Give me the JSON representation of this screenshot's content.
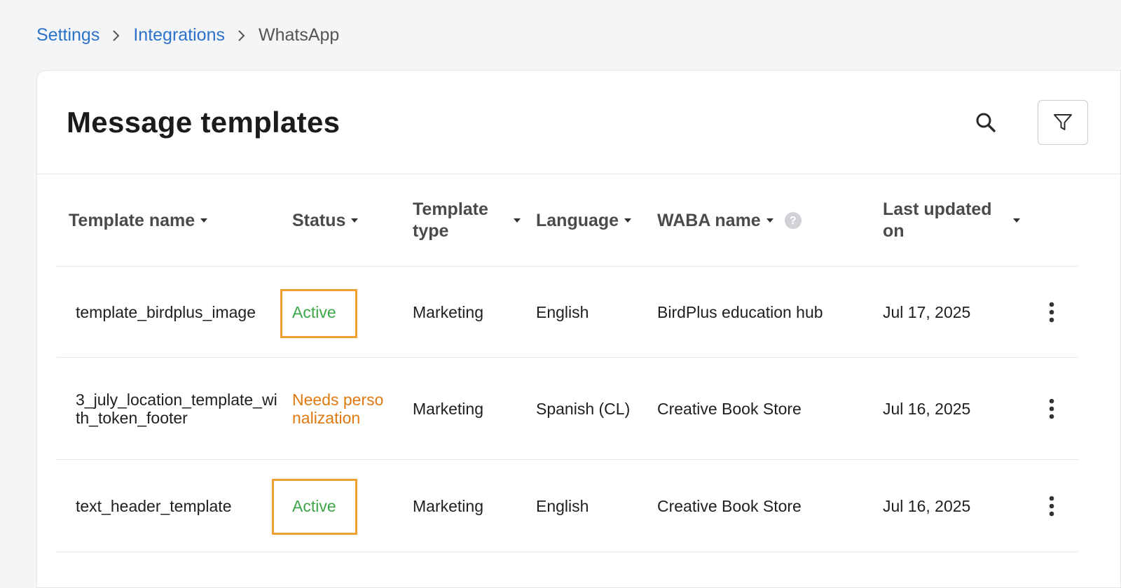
{
  "breadcrumb": {
    "items": [
      {
        "label": "Settings"
      },
      {
        "label": "Integrations"
      },
      {
        "label": "WhatsApp"
      }
    ]
  },
  "header": {
    "title": "Message templates",
    "search_icon": "search-icon",
    "filter_icon": "filter-icon"
  },
  "table": {
    "columns": [
      {
        "label": "Template name"
      },
      {
        "label": "Status"
      },
      {
        "label": "Template type"
      },
      {
        "label": "Language"
      },
      {
        "label": "WABA name"
      },
      {
        "label": "Last updated on"
      }
    ],
    "rows": [
      {
        "template_name": "template_birdplus_image",
        "status": "Active",
        "template_type": "Marketing",
        "language": "English",
        "waba_name": "BirdPlus education hub",
        "last_updated": "Jul 17, 2025"
      },
      {
        "template_name": "3_july_location_template_with_token_footer",
        "status": "Needs personalization",
        "template_type": "Marketing",
        "language": "Spanish (CL)",
        "waba_name": "Creative Book Store",
        "last_updated": "Jul 16, 2025"
      },
      {
        "template_name": "text_header_template",
        "status": "Active",
        "template_type": "Marketing",
        "language": "English",
        "waba_name": "Creative Book Store",
        "last_updated": "Jul 16, 2025"
      }
    ]
  },
  "colors": {
    "link": "#2b72c9",
    "status_active": "#3fa648",
    "status_needs": "#e07a10",
    "highlight": "#f0a030"
  }
}
